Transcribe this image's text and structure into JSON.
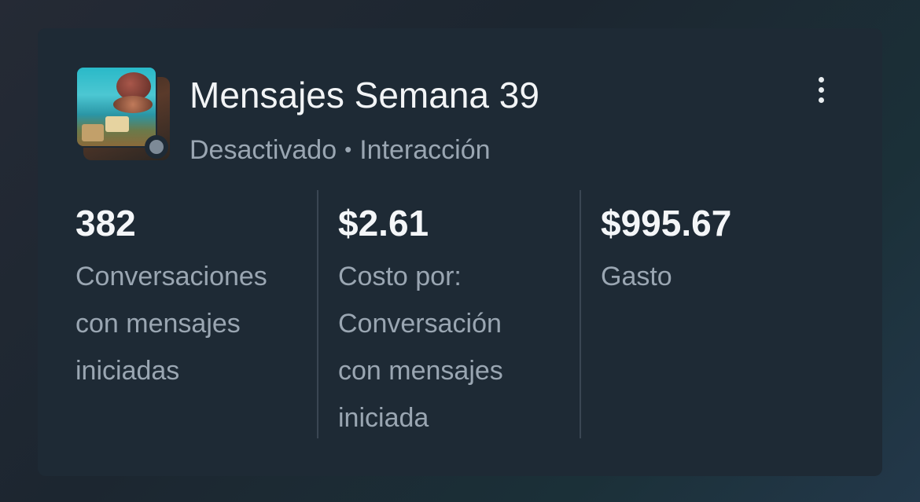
{
  "campaign": {
    "title": "Mensajes Semana 39",
    "status": "Desactivado",
    "separator": "•",
    "objective": "Interacción",
    "status_color": "#7d8a97"
  },
  "menu": {
    "icon": "more-vertical-icon"
  },
  "metrics": [
    {
      "value": "382",
      "label_lines": [
        "Conversaciones",
        "con mensajes",
        "iniciadas"
      ]
    },
    {
      "value": "$2.61",
      "label_lines": [
        "Costo por:",
        "Conversación",
        "con mensajes",
        "iniciada"
      ]
    },
    {
      "value": "$995.67",
      "label_lines": [
        "Gasto"
      ]
    }
  ]
}
